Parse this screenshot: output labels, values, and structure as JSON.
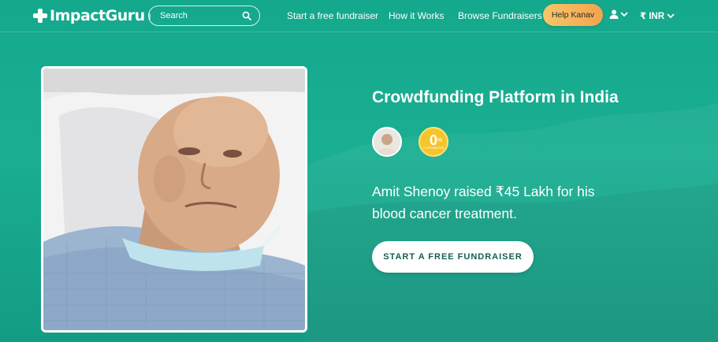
{
  "header": {
    "logo_text": "ImpactGuru",
    "logo_sub": ".com",
    "search": {
      "placeholder": "Search"
    },
    "nav": [
      {
        "label": "Start a free fundraiser"
      },
      {
        "label": "How it Works"
      },
      {
        "label": "Browse Fundraisers"
      }
    ],
    "help_button": "Help Kanav",
    "currency": "₹ INR"
  },
  "hero": {
    "title": "Crowdfunding Platform in India",
    "zero_badge": {
      "number": "0",
      "percent": "%",
      "caption": "PLATFORM FEE"
    },
    "story": "Amit Shenoy raised ₹45 Lakh for his blood cancer treatment.",
    "cta": "START A FREE FUNDRAISER"
  },
  "colors": {
    "background": "#14a88c",
    "help_button": "#f2a34d",
    "badge": "#f6c42b",
    "cta_text": "#155e51"
  }
}
